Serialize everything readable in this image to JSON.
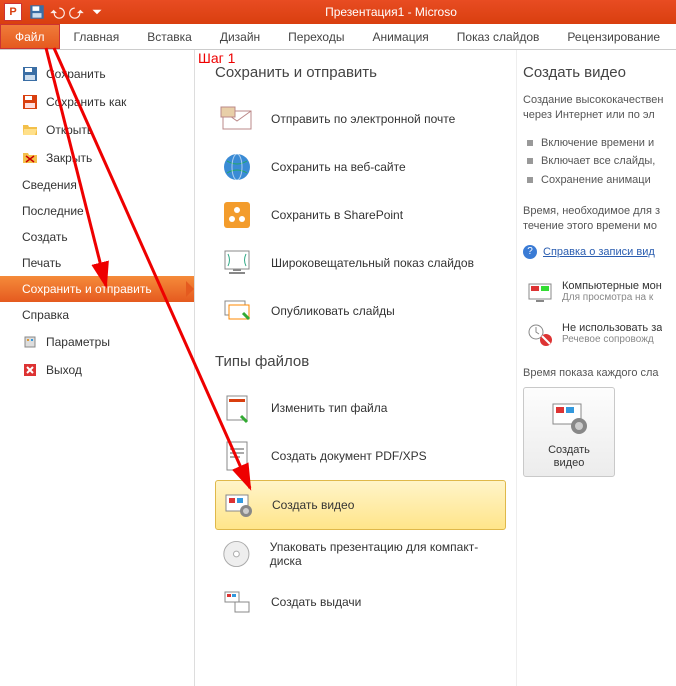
{
  "titlebar": {
    "title": "Презентация1 - Microso"
  },
  "tabs": {
    "file": "Файл",
    "items": [
      "Главная",
      "Вставка",
      "Дизайн",
      "Переходы",
      "Анимация",
      "Показ слайдов",
      "Рецензирование"
    ]
  },
  "annotation": {
    "step1": "Шаг 1"
  },
  "left_menu": {
    "save": "Сохранить",
    "save_as": "Сохранить как",
    "open": "Открыть",
    "close": "Закрыть",
    "info": "Сведения",
    "recent": "Последние",
    "new": "Создать",
    "print": "Печать",
    "save_send": "Сохранить и отправить",
    "help": "Справка",
    "options": "Параметры",
    "exit": "Выход"
  },
  "center": {
    "section1": "Сохранить и отправить",
    "send_email": "Отправить по электронной почте",
    "save_web": "Сохранить на веб-сайте",
    "save_sharepoint": "Сохранить в SharePoint",
    "broadcast": "Широковещательный показ слайдов",
    "publish": "Опубликовать слайды",
    "section2": "Типы файлов",
    "change_type": "Изменить тип файла",
    "create_pdf": "Создать документ PDF/XPS",
    "create_video": "Создать видео",
    "package_cd": "Упаковать презентацию для компакт-диска",
    "create_handouts": "Создать выдачи"
  },
  "right": {
    "title": "Создать видео",
    "desc": "Создание высококачествен через Интернет или по эл",
    "bullets": [
      "Включение времени и",
      "Включает все слайды,",
      "Сохранение анимаци"
    ],
    "time_text": "Время, необходимое для з течение этого времени мо",
    "help_link": "Справка о записи вид",
    "dd1_title": "Компьютерные мон",
    "dd1_sub": "Для просмотра на к",
    "dd2_title": "Не использовать за",
    "dd2_sub": "Речевое сопровожд",
    "duration_caption": "Время показа каждого сла",
    "big_button_line1": "Создать",
    "big_button_line2": "видео"
  }
}
